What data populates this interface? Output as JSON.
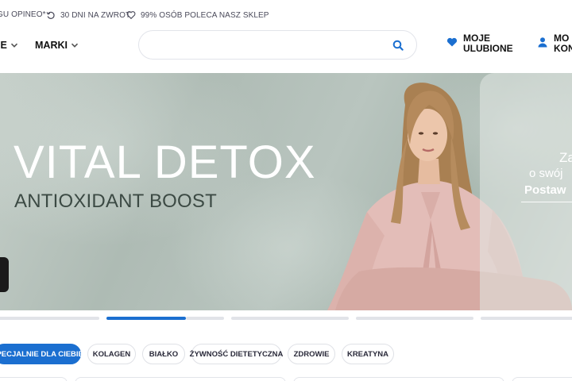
{
  "topbar": {
    "items": [
      {
        "icon": "badge-icon",
        "label": "GU OPINEO*"
      },
      {
        "icon": "return-icon",
        "label": "30 DNI NA ZWROT"
      },
      {
        "icon": "heart-outline-icon",
        "label": "99% OSÓB POLECA NASZ SKLEP"
      }
    ]
  },
  "nav": {
    "items": [
      {
        "label": "IE",
        "icon": "chevron-down-icon"
      },
      {
        "label": "MARKI",
        "icon": "chevron-down-icon"
      }
    ]
  },
  "search": {
    "placeholder": "",
    "value": "",
    "icon": "search-icon"
  },
  "header_actions": {
    "favorites": {
      "line1": "MOJE",
      "line2": "ULUBIONE",
      "icon": "heart-icon"
    },
    "account": {
      "line1": "MO",
      "line2": "KON",
      "icon": "user-icon"
    }
  },
  "hero": {
    "title": "VITAL DETOX",
    "subtitle": "ANTIOXIDANT BOOST",
    "peek": {
      "line1": "Za",
      "line2": "o swój",
      "line3": "Postaw"
    }
  },
  "slider": {
    "count": 5,
    "active_index": 1
  },
  "categories": [
    {
      "label": "SPECJALNIE DLA CIEBIE",
      "active": true
    },
    {
      "label": "KOLAGEN",
      "active": false
    },
    {
      "label": "BIAŁKO",
      "active": false
    },
    {
      "label": "ŻYWNOŚĆ DIETETYCZNA",
      "active": false
    },
    {
      "label": "ZDROWIE",
      "active": false
    },
    {
      "label": "KREATYNA",
      "active": false
    }
  ],
  "colors": {
    "accent": "#1b6fd0",
    "text": "#1a1a2e",
    "border": "#dfe1e6"
  }
}
